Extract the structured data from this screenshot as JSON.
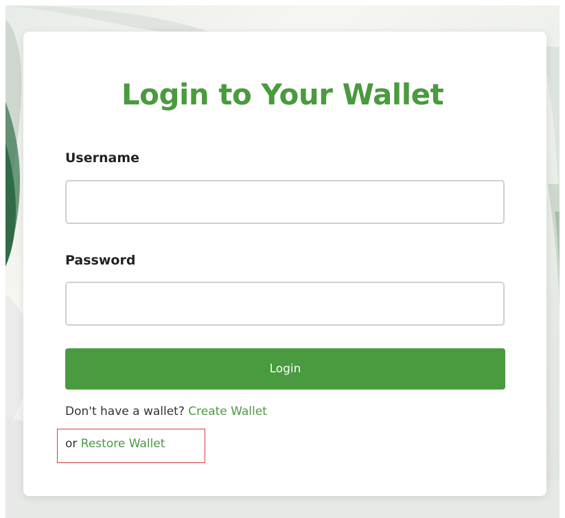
{
  "login": {
    "title": "Login to Your Wallet",
    "username_label": "Username",
    "username_value": "",
    "password_label": "Password",
    "password_value": "",
    "login_button": "Login",
    "no_wallet_text": "Don't have a wallet?",
    "create_wallet_link": "Create Wallet",
    "or_text": "or",
    "restore_wallet_link": "Restore Wallet"
  },
  "colors": {
    "accent": "#4a9a3f",
    "highlight": "#d9363e",
    "text": "#222222"
  }
}
